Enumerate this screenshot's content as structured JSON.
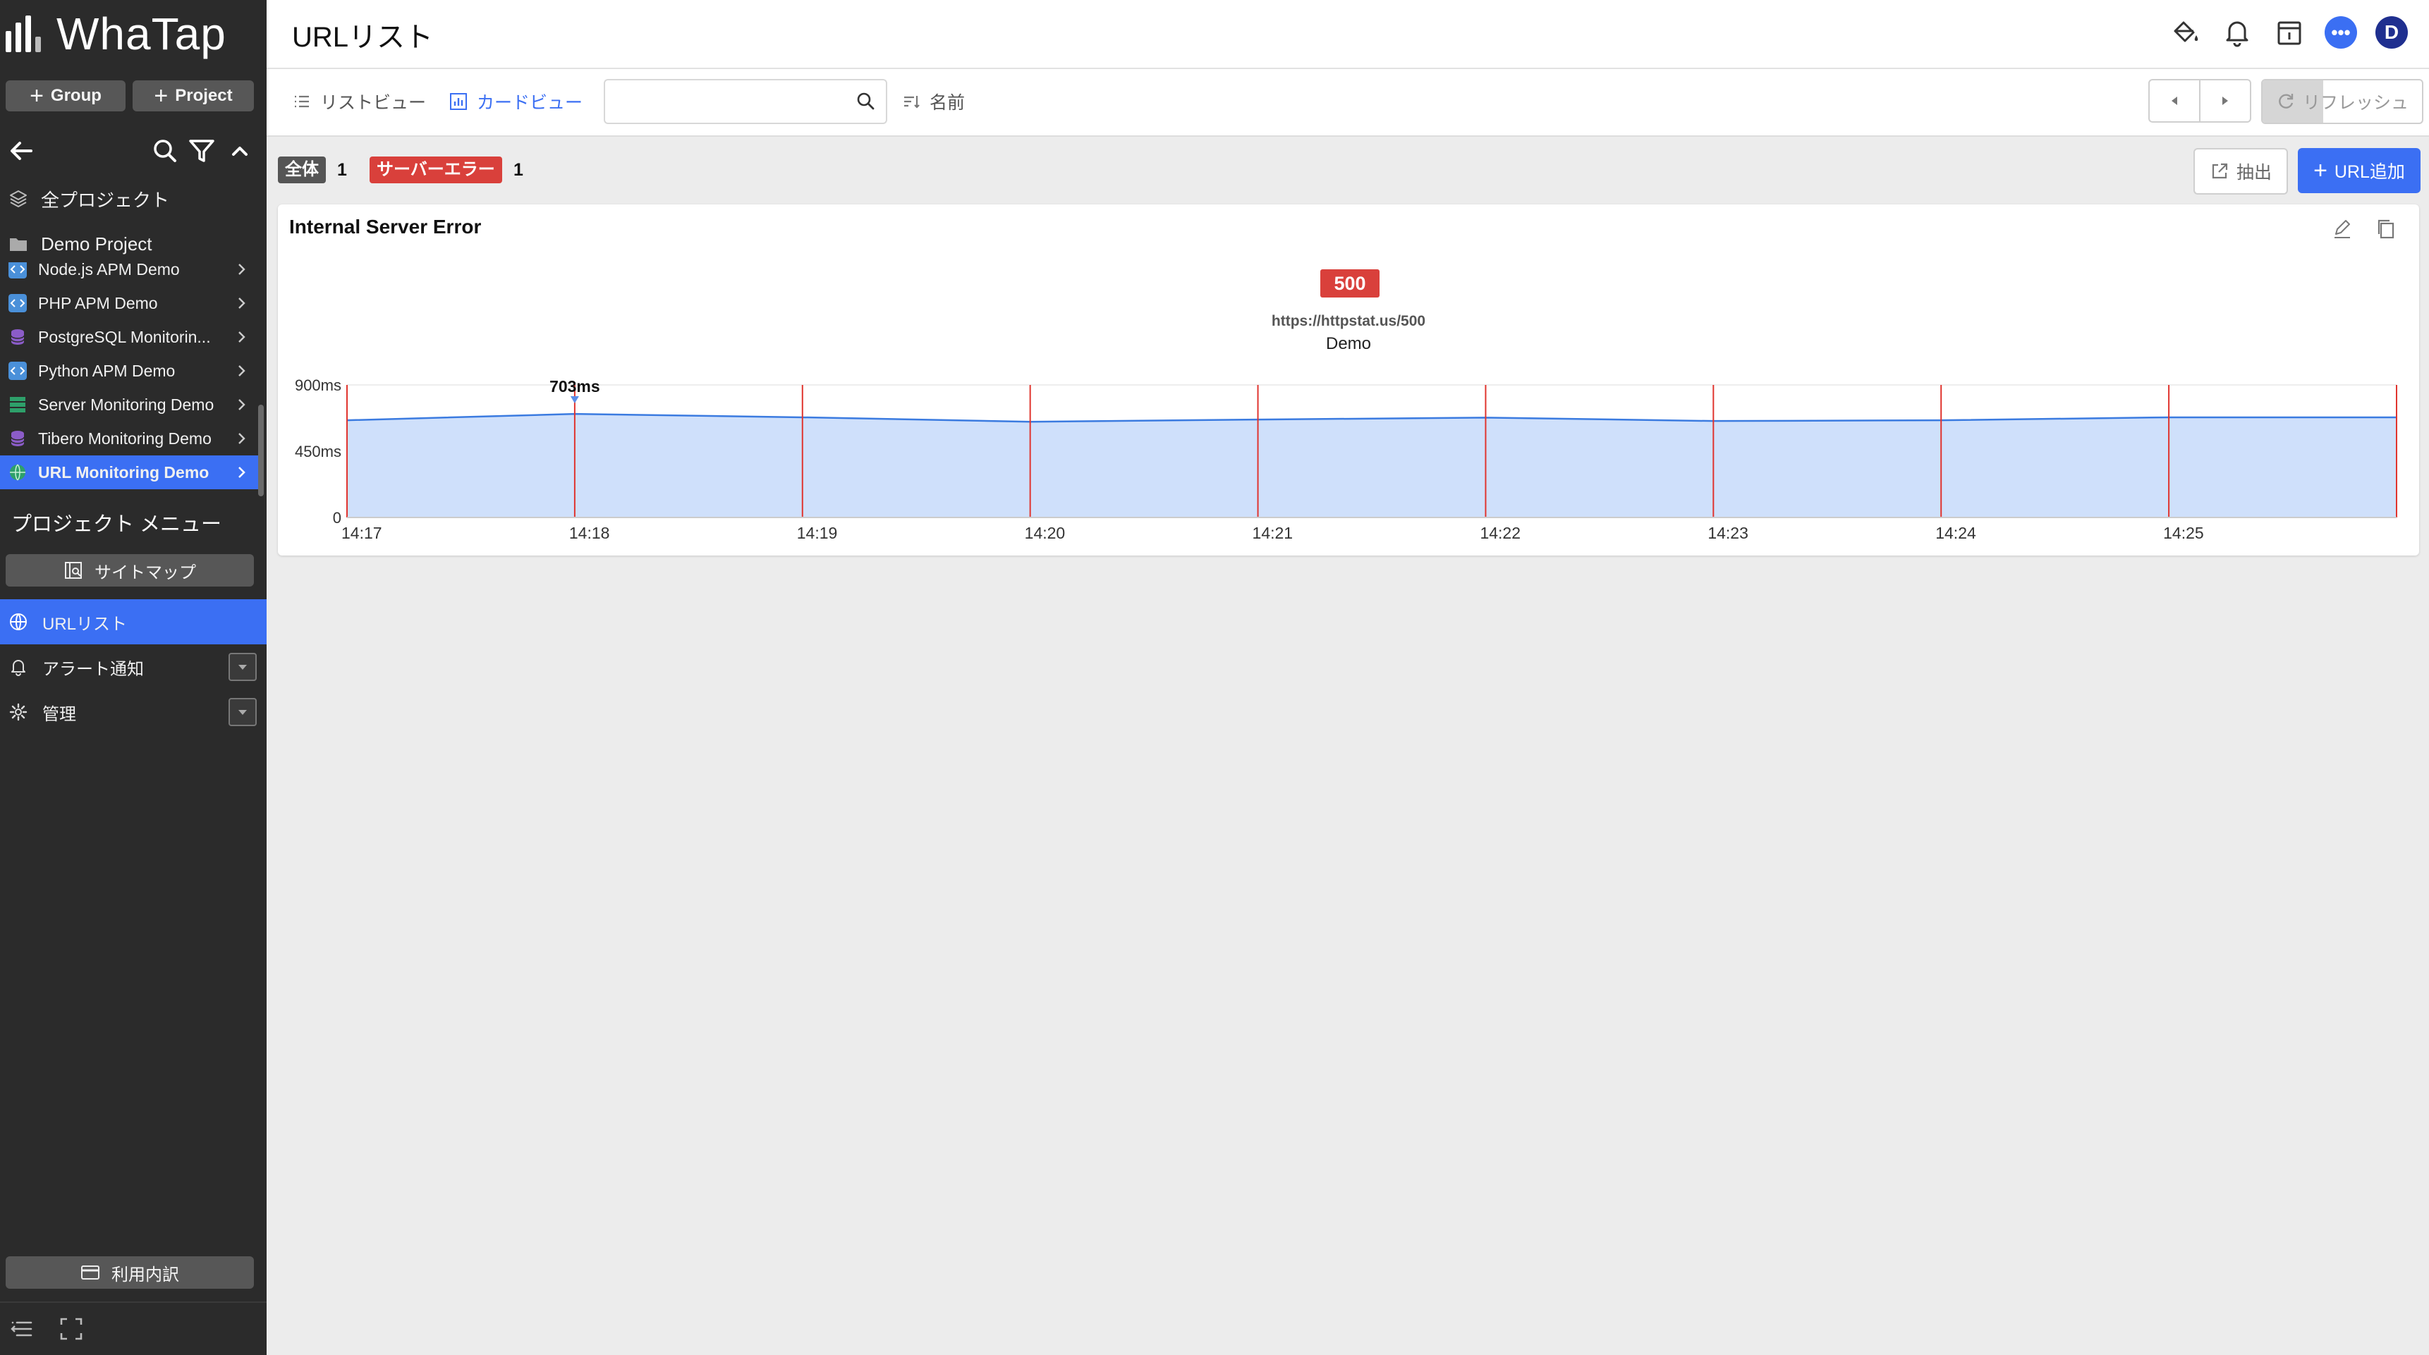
{
  "brand": {
    "name": "WhaTap"
  },
  "sidebar": {
    "group_btn": "Group",
    "project_btn": "Project",
    "all_projects": "全プロジェクト",
    "folder": "Demo Project",
    "projects": [
      {
        "label": "Node.js APM Demo",
        "icon": "code-icon",
        "color": "#4a90d9"
      },
      {
        "label": "PHP APM Demo",
        "icon": "code-icon",
        "color": "#4a90d9"
      },
      {
        "label": "PostgreSQL Monitorin...",
        "icon": "database-icon",
        "color": "#8b5cc8"
      },
      {
        "label": "Python APM Demo",
        "icon": "code-icon",
        "color": "#4a90d9"
      },
      {
        "label": "Server Monitoring Demo",
        "icon": "server-icon",
        "color": "#2ea06a"
      },
      {
        "label": "Tibero Monitoring Demo",
        "icon": "database-icon",
        "color": "#8b5cc8"
      },
      {
        "label": "URL Monitoring Demo",
        "icon": "globe-icon",
        "color": "#2ea06a"
      }
    ],
    "menu_title": "プロジェクト メニュー",
    "sitemap": "サイトマップ",
    "nav": [
      {
        "label": "URLリスト",
        "icon": "globe-icon"
      },
      {
        "label": "アラート通知",
        "icon": "bell-icon"
      },
      {
        "label": "管理",
        "icon": "gear-icon"
      }
    ],
    "billing": "利用内訳"
  },
  "header": {
    "title": "URLリスト"
  },
  "toolbar": {
    "list_view": "リストビュー",
    "card_view": "カードビュー",
    "search_placeholder": "",
    "sort": "名前",
    "refresh": "リフレッシュ"
  },
  "filters": [
    {
      "label": "全体",
      "count": "1",
      "color": "#555555"
    },
    {
      "label": "サーバーエラー",
      "count": "1",
      "color": "#d9403b"
    }
  ],
  "actions": {
    "extract": "抽出",
    "add_url": "URL追加"
  },
  "card": {
    "title": "Internal Server Error",
    "status_code": "500",
    "url": "https://httpstat.us/500",
    "project": "Demo"
  },
  "chart_data": {
    "type": "area",
    "x": [
      "14:17",
      "14:18",
      "14:19",
      "14:20",
      "14:21",
      "14:22",
      "14:23",
      "14:24",
      "14:25",
      "14:26"
    ],
    "values": [
      660,
      703,
      680,
      650,
      665,
      678,
      655,
      660,
      680,
      680
    ],
    "yticks": [
      "900ms",
      "450ms",
      "0"
    ],
    "xticks": [
      "14:17",
      "14:18",
      "14:19",
      "14:20",
      "14:21",
      "14:22",
      "14:23",
      "14:24",
      "14:25"
    ],
    "ylim": [
      0,
      900
    ],
    "annotation": "703ms",
    "error_markers": [
      "14:17",
      "14:18",
      "14:19",
      "14:20",
      "14:21",
      "14:22",
      "14:23",
      "14:24",
      "14:25",
      "14:26"
    ],
    "series_color": "#3b7be0",
    "fill_color": "#cfe0fb",
    "marker_color": "#e0342e"
  }
}
